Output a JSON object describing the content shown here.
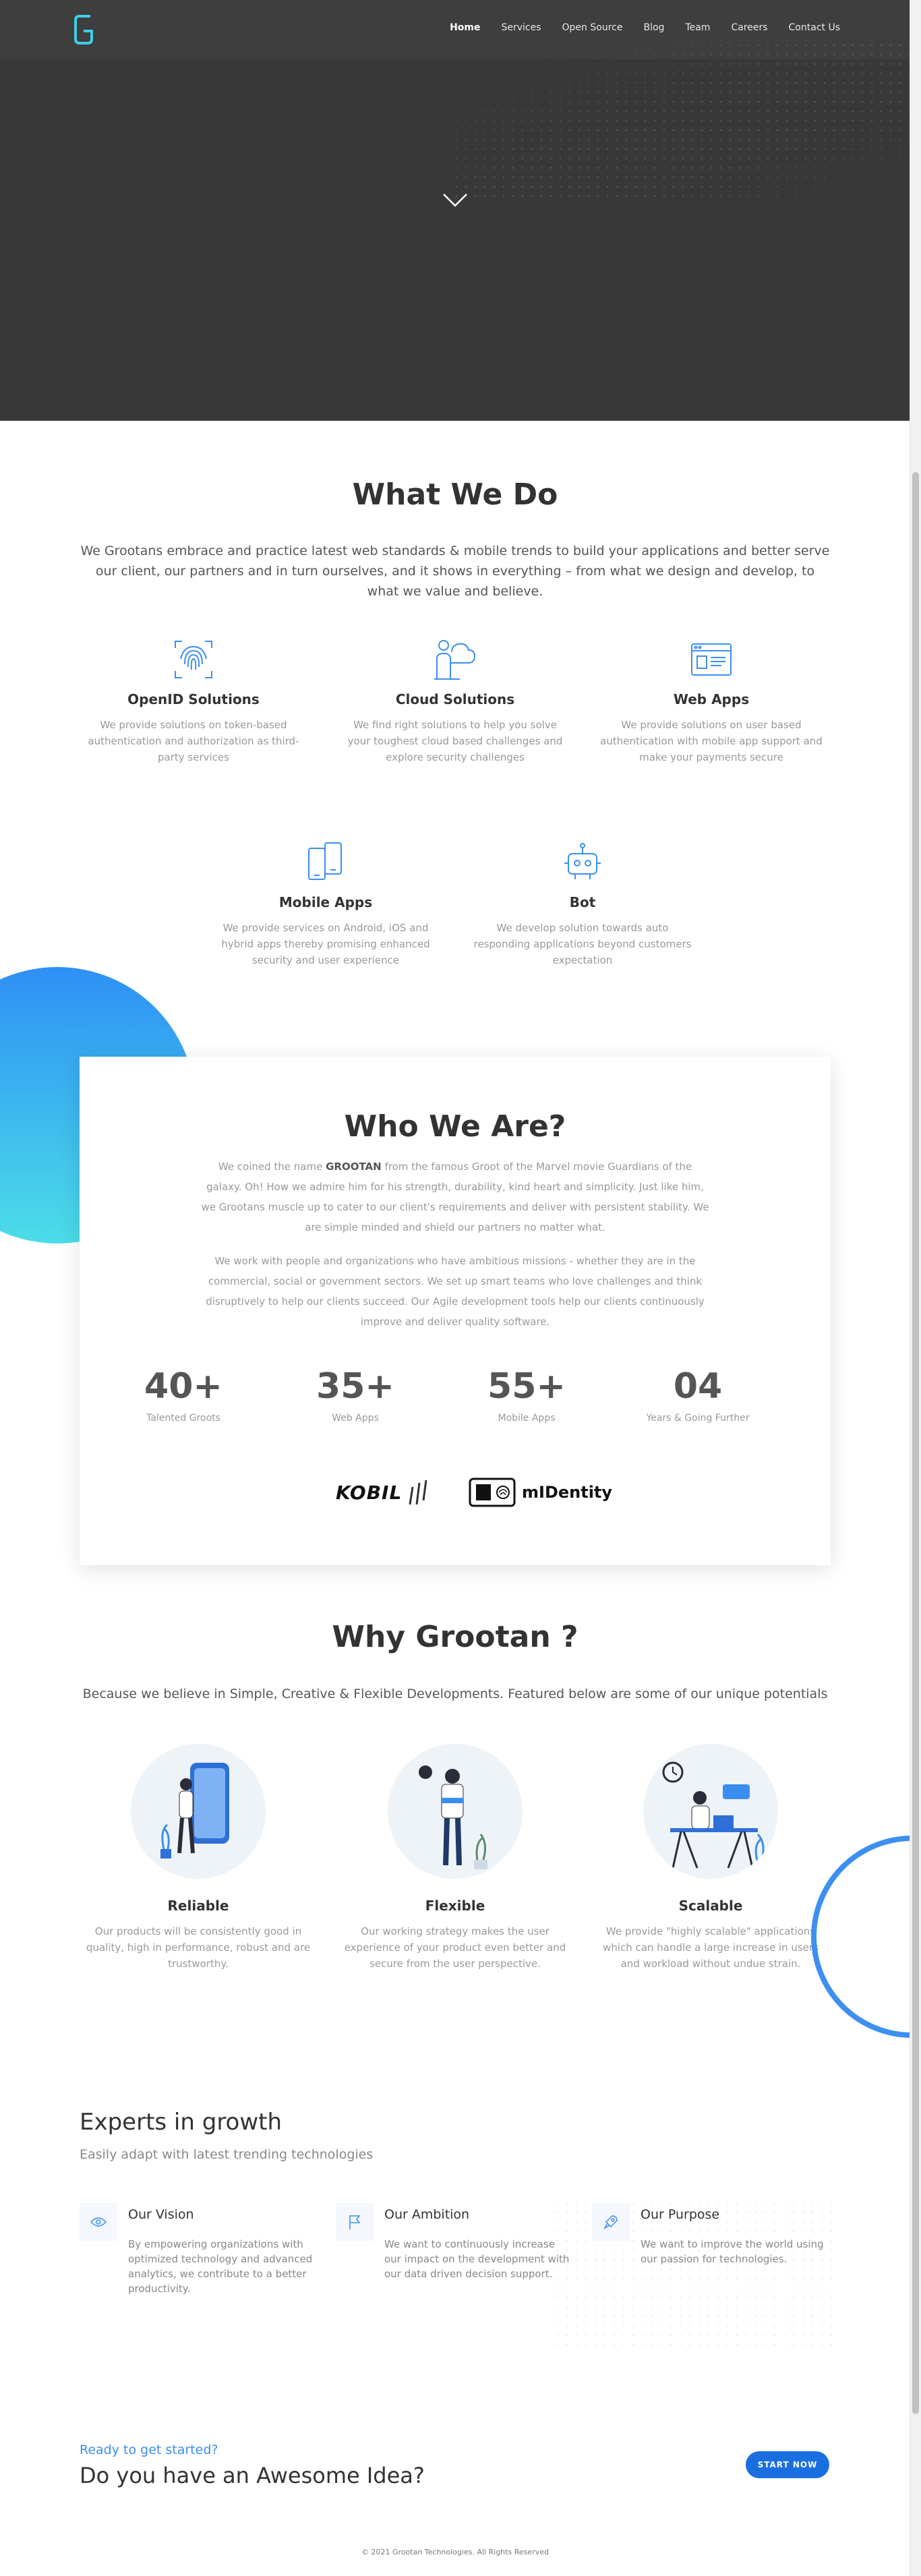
{
  "nav": {
    "items": [
      {
        "label": "Home",
        "active": true
      },
      {
        "label": "Services"
      },
      {
        "label": "Open Source"
      },
      {
        "label": "Blog"
      },
      {
        "label": "Team"
      },
      {
        "label": "Careers"
      },
      {
        "label": "Contact Us"
      }
    ]
  },
  "colors": {
    "brand_blue": "#3b8ef0",
    "hero_bg": "#383838",
    "logo_cyan": "#3ecfe8"
  },
  "what_we_do": {
    "title": "What We Do",
    "description": "We Grootans embrace and practice latest web standards & mobile trends to build your applications and better serve our client, our partners and in turn ourselves, and it shows in everything – from what we design and develop, to what we value and believe.",
    "services": [
      {
        "title": "OpenID Solutions",
        "text": "We provide solutions on token-based authentication and authorization as third-party services",
        "icon": "fingerprint-icon"
      },
      {
        "title": "Cloud Solutions",
        "text": "We find right solutions to help you solve your toughest cloud based challenges and explore security challenges",
        "icon": "cloud-user-icon"
      },
      {
        "title": "Web Apps",
        "text": "We provide solutions on user based authentication with mobile app support and make your payments secure",
        "icon": "browser-icon"
      },
      {
        "title": "Mobile Apps",
        "text": "We provide services on Android, iOS and hybrid apps thereby promising enhanced security and user experience",
        "icon": "mobile-devices-icon"
      },
      {
        "title": "Bot",
        "text": "We develop solution towards auto responding applications beyond customers expectation",
        "icon": "robot-icon"
      }
    ]
  },
  "who_we_are": {
    "title": "Who We Are?",
    "p1_pre": "We coined the name ",
    "p1_bold": "GROOTAN",
    "p1_post": " from the famous Groot of the Marvel movie Guardians of the galaxy. Oh! How we admire him for his strength, durability, kind heart and simplicity. Just like him, we Grootans muscle up to cater to our client's requirements and deliver with persistent stability. We are simple minded and shield our partners no matter what.",
    "p2": "We work with people and organizations who have ambitious missions - whether they are in the commercial, social or government sectors. We set up smart teams who love challenges and think disruptively to help our clients succeed. Our Agile development tools help our clients continuously improve and deliver quality software.",
    "stats": [
      {
        "value": "40+",
        "label": "Talented Groots"
      },
      {
        "value": "35+",
        "label": "Web Apps"
      },
      {
        "value": "55+",
        "label": "Mobile Apps"
      },
      {
        "value": "04",
        "label": "Years & Going Further"
      }
    ],
    "partners": [
      {
        "name": "KOBIL"
      },
      {
        "name": "mIDentity"
      }
    ]
  },
  "why_grootan": {
    "title": "Why Grootan ?",
    "description": "Because we believe in Simple, Creative & Flexible Developments. Featured below are some of our unique potentials",
    "items": [
      {
        "title": "Reliable",
        "text": "Our products will be consistently good in quality, high in performance, robust and are trustworthy."
      },
      {
        "title": "Flexible",
        "text": "Our working strategy makes the user experience of your product even better and secure from the user perspective."
      },
      {
        "title": "Scalable",
        "text": "We provide \"highly scalable\" applications which can handle a large increase in users and workload without undue strain."
      }
    ]
  },
  "experts": {
    "title": "Experts in growth",
    "subtitle": "Easily adapt with latest trending technologies",
    "items": [
      {
        "title": "Our Vision",
        "text": "By empowering organizations with optimized technology and advanced analytics, we contribute to a better productivity.",
        "icon": "eye-icon"
      },
      {
        "title": "Our Ambition",
        "text": "We want to continuously increase our impact on the development with our data driven decision support.",
        "icon": "flag-icon"
      },
      {
        "title": "Our Purpose",
        "text": "We want to improve the world using our passion for technologies.",
        "icon": "rocket-icon"
      }
    ]
  },
  "cta": {
    "kicker": "Ready to get started?",
    "headline": "Do you have an Awesome Idea?",
    "button": "START NOW"
  },
  "footer": {
    "copyright": "© 2021 Grootan Technologies. All Rights Reserved"
  }
}
